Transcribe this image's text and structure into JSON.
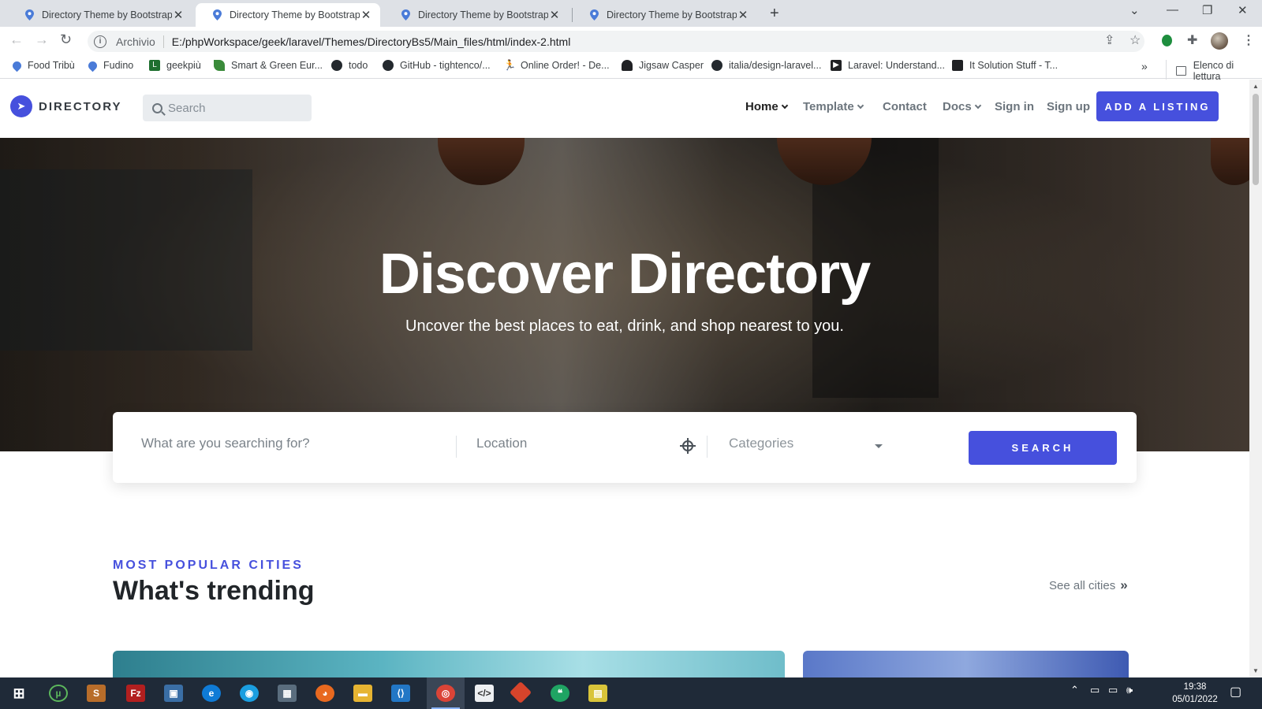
{
  "browser": {
    "tabs": [
      {
        "title": "Directory Theme by Bootstrapious"
      },
      {
        "title": "Directory Theme by Bootstrapious"
      },
      {
        "title": "Directory Theme by Bootstrapious"
      },
      {
        "title": "Directory Theme by Bootstrapious"
      }
    ],
    "active_tab": 1,
    "address": {
      "scheme_label": "Archivio",
      "url": "E:/phpWorkspace/geek/laravel/Themes/DirectoryBs5/Main_files/html/index-2.html"
    },
    "bookmarks": [
      {
        "label": "Food Tribù",
        "icon": "pin-icon"
      },
      {
        "label": "Fudino",
        "icon": "pin-icon"
      },
      {
        "label": "geekpiù",
        "icon": "geek-icon"
      },
      {
        "label": "Smart & Green Eur...",
        "icon": "leaf-icon"
      },
      {
        "label": "todo",
        "icon": "github-icon"
      },
      {
        "label": "GitHub - tightenco/...",
        "icon": "github-icon"
      },
      {
        "label": "Online Order! - De...",
        "icon": "runner-icon"
      },
      {
        "label": "Jigsaw Casper",
        "icon": "ghost-icon"
      },
      {
        "label": "italia/design-laravel...",
        "icon": "github-icon"
      },
      {
        "label": "Laravel: Understand...",
        "icon": "video-icon"
      },
      {
        "label": "It Solution Stuff - T...",
        "icon": "site-icon"
      }
    ],
    "more_bookmarks": "»",
    "reading_list": "Elenco di lettura"
  },
  "site": {
    "brand": "DIRECTORY",
    "search_placeholder": "Search",
    "nav": [
      {
        "label": "Home",
        "dropdown": true,
        "active": true
      },
      {
        "label": "Template",
        "dropdown": true
      },
      {
        "label": "Contact",
        "dropdown": false
      },
      {
        "label": "Docs",
        "dropdown": true
      },
      {
        "label": "Sign in",
        "dropdown": false
      },
      {
        "label": "Sign up",
        "dropdown": false
      }
    ],
    "cta": "ADD A LISTING",
    "accent": "#4650dd"
  },
  "hero": {
    "title": "Discover Directory",
    "subtitle": "Uncover the best places to eat, drink, and shop nearest to you."
  },
  "search_form": {
    "query_placeholder": "What are you searching for?",
    "location_placeholder": "Location",
    "categories_label": "Categories",
    "button": "SEARCH"
  },
  "trending": {
    "eyebrow": "MOST POPULAR CITIES",
    "title": "What's trending",
    "see_all": "See all cities"
  },
  "taskbar": {
    "time": "19:38",
    "date": "05/01/2022"
  }
}
